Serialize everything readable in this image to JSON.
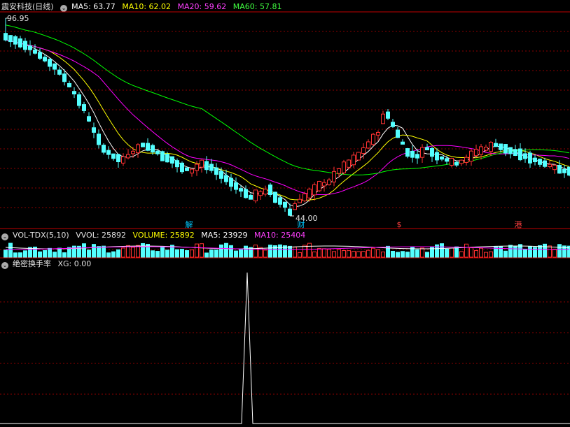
{
  "main_header": {
    "stock_name": "震安科技(日线)",
    "ma5": "MA5: 63.77",
    "ma10": "MA10: 62.02",
    "ma20": "MA20: 59.62",
    "ma60": "MA60: 57.81"
  },
  "vol_header": {
    "name": "VOL-TDX(5,10)",
    "vvol": "VVOL: 25892",
    "volume": "VOLUME: 25892",
    "ma5": "MA5: 23929",
    "ma10": "MA10: 25404"
  },
  "ind_header": {
    "name": "绝密换手率",
    "xg": "XG: 0.00"
  },
  "price_labels": {
    "high": "96.95",
    "low": "44.00"
  },
  "event_markers": [
    {
      "label": "解",
      "color": "#00c8ff"
    },
    {
      "label": "财",
      "color": "#00c8ff"
    },
    {
      "label": "$",
      "color": "#ff4040"
    },
    {
      "label": "港",
      "color": "#ff4040"
    }
  ],
  "colors": {
    "up": "#ff3232",
    "down": "#54ffff",
    "ma5": "#ffffff",
    "ma10": "#ffff00",
    "ma20": "#ff00ff",
    "ma60": "#00ff00",
    "grid": "#8b0000",
    "frame": "#c00000"
  },
  "chart_data": {
    "type": "candlestick",
    "y_high": 96.95,
    "y_low": 44.0,
    "xg_peak_value": 1,
    "xg_peak_bar": 43
  }
}
